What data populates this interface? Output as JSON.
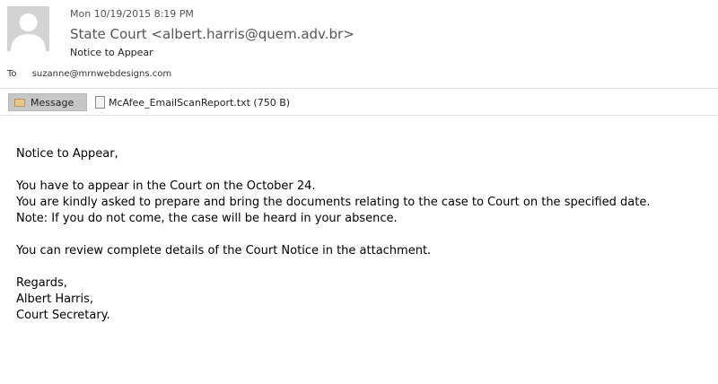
{
  "header": {
    "date": "Mon 10/19/2015 8:19 PM",
    "sender": "State Court <albert.harris@quem.adv.br>",
    "subject": "Notice to Appear",
    "to_label": "To",
    "to_value": "suzanne@mrnwebdesigns.com"
  },
  "attachments": {
    "message_tab": "Message",
    "file": "McAfee_EmailScanReport.txt (750 B)"
  },
  "body": {
    "greeting": "Notice to Appear,",
    "line1": "You have to appear in the Court on the October 24.",
    "line2": "You are kindly asked to prepare and bring the documents relating to the case to Court on the specified date.",
    "line3": "Note: If you do not come, the case will be heard in your absence.",
    "line4": "You can review complete details of the Court Notice in the attachment.",
    "signoff1": "Regards,",
    "signoff2": "Albert Harris,",
    "signoff3": "Court Secretary."
  }
}
